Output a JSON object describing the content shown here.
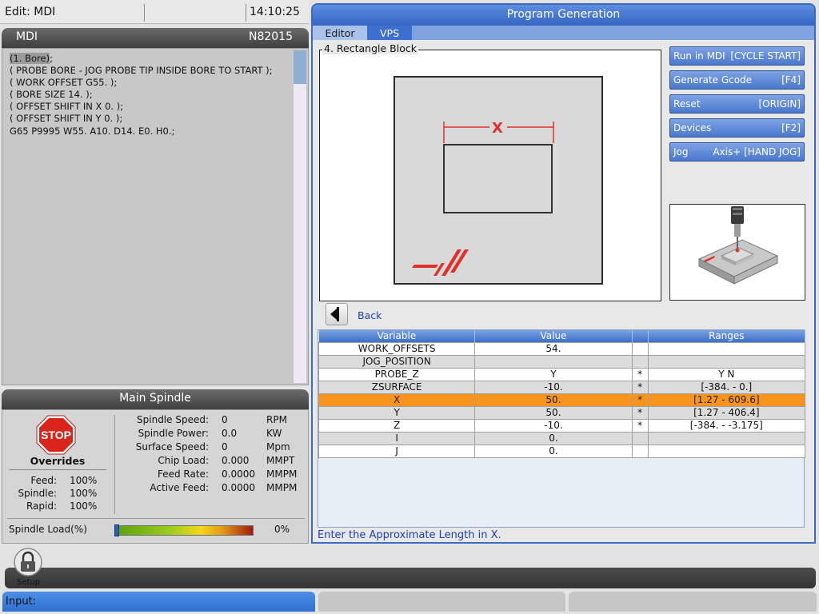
{
  "status_bar": {
    "mode": "Edit: MDI",
    "clock": "14:10:25"
  },
  "mdi": {
    "title": "MDI",
    "program_number": "N82015",
    "lines": [
      "(1. Bore);",
      "( PROBE BORE - JOG PROBE TIP INSIDE BORE TO START );",
      "( WORK OFFSET G55. );",
      "( BORE SIZE 14. );",
      "( OFFSET SHIFT IN X 0. );",
      "( OFFSET SHIFT IN Y 0. );",
      "G65 P9995 W55. A10. D14. E0. H0.;"
    ],
    "highlighted_token": "(1. Bore)"
  },
  "spindle": {
    "title": "Main Spindle",
    "stop_label": "STOP",
    "overrides_title": "Overrides",
    "overrides": [
      {
        "label": "Feed:",
        "value": "100%"
      },
      {
        "label": "Spindle:",
        "value": "100%"
      },
      {
        "label": "Rapid:",
        "value": "100%"
      }
    ],
    "stats": [
      {
        "label": "Spindle Speed:",
        "value": "0",
        "unit": "RPM"
      },
      {
        "label": "Spindle Power:",
        "value": "0.0",
        "unit": "KW"
      },
      {
        "label": "Surface Speed:",
        "value": "0",
        "unit": "Mpm"
      },
      {
        "label": "Chip Load:",
        "value": "0.000",
        "unit": "MMPT"
      },
      {
        "label": "Feed Rate:",
        "value": "0.0000",
        "unit": "MMPM"
      },
      {
        "label": "Active Feed:",
        "value": "0.0000",
        "unit": "MMPM"
      }
    ],
    "load_label": "Spindle Load(%)",
    "load_value": "0%",
    "load_fraction": 0.0
  },
  "program_generation": {
    "title": "Program Generation",
    "tabs": [
      {
        "label": "Editor",
        "active": false
      },
      {
        "label": "VPS",
        "active": true
      }
    ],
    "group_title": "4. Rectangle Block",
    "diagram_dimension_label": "X",
    "buttons": [
      {
        "label": "Run in MDI",
        "key": "[CYCLE START]"
      },
      {
        "label": "Generate Gcode",
        "key": "[F4]"
      },
      {
        "label": "Reset",
        "key": "[ORIGIN]"
      },
      {
        "label": "Devices",
        "key": "[F2]"
      },
      {
        "label": "Jog",
        "key": "Axis+ [HAND JOG]"
      }
    ],
    "back_label": "Back",
    "table": {
      "headers": [
        "Variable",
        "Value",
        "",
        "Ranges"
      ],
      "rows": [
        {
          "variable": "WORK_OFFSETS",
          "value": "54.",
          "flag": "",
          "range": ""
        },
        {
          "variable": "JOG_POSITION",
          "value": "",
          "flag": "",
          "range": ""
        },
        {
          "variable": "PROBE_Z",
          "value": "Y",
          "flag": "*",
          "range": "Y N"
        },
        {
          "variable": "ZSURFACE",
          "value": "-10.",
          "flag": "*",
          "range": "[-384. - 0.]"
        },
        {
          "variable": "X",
          "value": "50.",
          "flag": "*",
          "range": "[1.27 - 609.6]"
        },
        {
          "variable": "Y",
          "value": "50.",
          "flag": "*",
          "range": "[1.27 - 406.4]"
        },
        {
          "variable": "Z",
          "value": "-10.",
          "flag": "*",
          "range": "[-384. - -3.175]"
        },
        {
          "variable": "I",
          "value": "0.",
          "flag": "",
          "range": ""
        },
        {
          "variable": "J",
          "value": "0.",
          "flag": "",
          "range": ""
        }
      ],
      "selected_row": 4
    },
    "prompt": "Enter the Approximate Length in X."
  },
  "bottom": {
    "setup_label": "Setup",
    "input_label": "Input:"
  },
  "colors": {
    "accent_blue": "#3b6bc6",
    "selection_orange": "#f7941d",
    "stop_red": "#d9241b",
    "haas_red": "#e0302a"
  }
}
